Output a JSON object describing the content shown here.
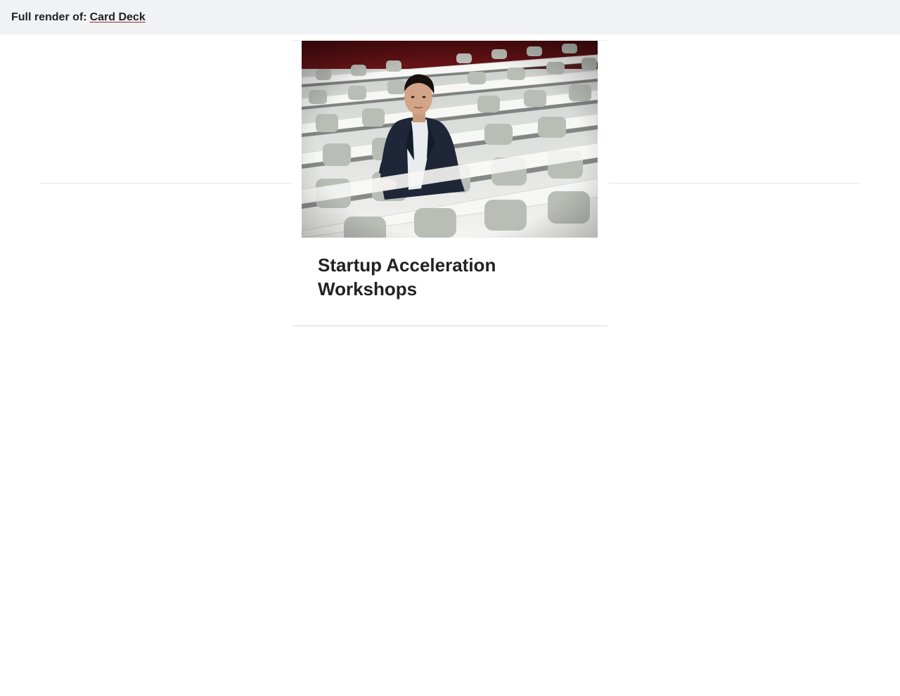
{
  "header": {
    "prefix": "Full render of:",
    "link_label": "Card Deck"
  },
  "card": {
    "title": "Startup Acceleration Workshops",
    "image_subject": "man-seated-in-lecture-hall-photo"
  },
  "colors": {
    "header_bg": "#f1f2f4",
    "link_underline": "#a3222c",
    "text": "#222222",
    "divider": "#e3e3e3"
  }
}
